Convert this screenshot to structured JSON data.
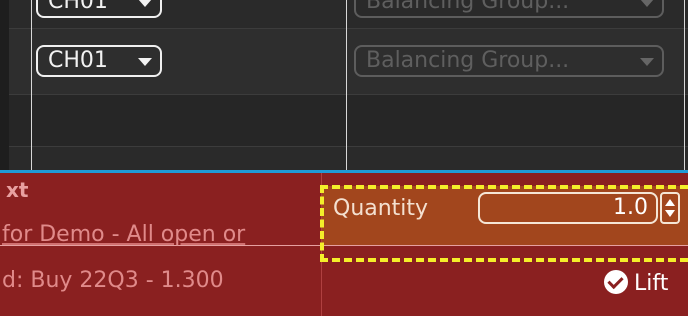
{
  "grid": {
    "rows": [
      {
        "channel": "CH01",
        "balancing_group": "Balancing Group..."
      },
      {
        "channel": "CH01",
        "balancing_group": "Balancing Group..."
      }
    ]
  },
  "panel": {
    "title_fragment": "xt",
    "description_fragment": "for Demo - All open or",
    "order_fragment": "d: Buy 22Q3 - 1.300",
    "quantity_label": "Quantity",
    "quantity_value": "1.0",
    "lift_label": "Lift"
  },
  "colors": {
    "panel_red": "#8a2020",
    "focus_highlight": "#f4ee2a",
    "selection_blue": "#1f9bd6",
    "quantity_orange": "#a2461d"
  },
  "icons": {
    "dropdown": "caret-down-icon",
    "spinner": "spinner-arrows-icon",
    "lift": "check-circle-icon"
  }
}
